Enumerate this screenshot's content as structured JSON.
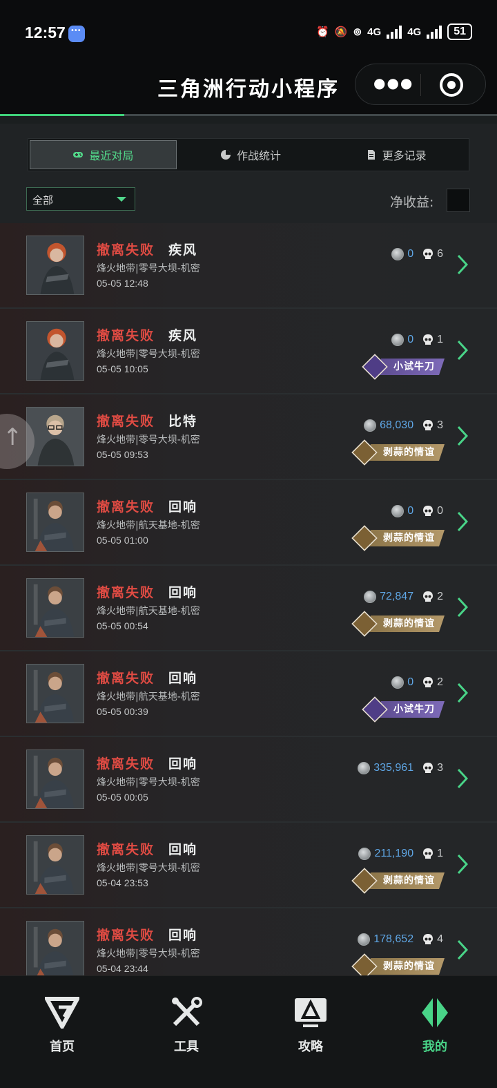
{
  "status_bar": {
    "time": "12:57",
    "network_1": "4G",
    "network_2": "4G",
    "battery": "51"
  },
  "header": {
    "title": "三角洲行动小程序"
  },
  "tabs": [
    {
      "label": "最近对局",
      "icon": "gamepad-icon",
      "active": true
    },
    {
      "label": "作战统计",
      "icon": "pie-chart-icon",
      "active": false
    },
    {
      "label": "更多记录",
      "icon": "document-icon",
      "active": false
    }
  ],
  "filter": {
    "selected": "全部"
  },
  "net_income_label": "净收益:",
  "matches": [
    {
      "result": "撤离失败",
      "operator": "疾风",
      "map": "烽火地带|零号大坝-机密",
      "time": "05-05 12:48",
      "value": "0",
      "kills": "6",
      "badge": "",
      "avatar": "female"
    },
    {
      "result": "撤离失败",
      "operator": "疾风",
      "map": "烽火地带|零号大坝-机密",
      "time": "05-05 10:05",
      "value": "0",
      "kills": "1",
      "badge": "小试牛刀",
      "badge_style": "purple",
      "avatar": "female"
    },
    {
      "result": "撤离失败",
      "operator": "比特",
      "map": "烽火地带|零号大坝-机密",
      "time": "05-05 09:53",
      "value": "68,030",
      "kills": "3",
      "badge": "剥蒜的情谊",
      "badge_style": "gold",
      "avatar": "glasses"
    },
    {
      "result": "撤离失败",
      "operator": "回响",
      "map": "烽火地带|航天基地-机密",
      "time": "05-05 01:00",
      "value": "0",
      "kills": "0",
      "badge": "剥蒜的情谊",
      "badge_style": "gold",
      "avatar": "male"
    },
    {
      "result": "撤离失败",
      "operator": "回响",
      "map": "烽火地带|航天基地-机密",
      "time": "05-05 00:54",
      "value": "72,847",
      "kills": "2",
      "badge": "剥蒜的情谊",
      "badge_style": "gold",
      "avatar": "male"
    },
    {
      "result": "撤离失败",
      "operator": "回响",
      "map": "烽火地带|航天基地-机密",
      "time": "05-05 00:39",
      "value": "0",
      "kills": "2",
      "badge": "小试牛刀",
      "badge_style": "purple",
      "avatar": "male"
    },
    {
      "result": "撤离失败",
      "operator": "回响",
      "map": "烽火地带|零号大坝-机密",
      "time": "05-05 00:05",
      "value": "335,961",
      "kills": "3",
      "badge": "",
      "avatar": "male"
    },
    {
      "result": "撤离失败",
      "operator": "回响",
      "map": "烽火地带|零号大坝-机密",
      "time": "05-04 23:53",
      "value": "211,190",
      "kills": "1",
      "badge": "剥蒜的情谊",
      "badge_style": "gold",
      "avatar": "male"
    },
    {
      "result": "撤离失败",
      "operator": "回响",
      "map": "烽火地带|零号大坝-机密",
      "time": "05-04 23:44",
      "value": "178,652",
      "kills": "4",
      "badge": "剥蒜的情谊",
      "badge_style": "gold",
      "avatar": "male"
    }
  ],
  "bottom_nav": [
    {
      "label": "首页",
      "icon": "home-logo-icon",
      "active": false
    },
    {
      "label": "工具",
      "icon": "tools-icon",
      "active": false
    },
    {
      "label": "攻略",
      "icon": "guide-monitor-icon",
      "active": false
    },
    {
      "label": "我的",
      "icon": "profile-logo-icon",
      "active": true
    }
  ],
  "colors": {
    "accent": "#49d488",
    "fail": "#e04b43",
    "value": "#5fa7e6"
  }
}
